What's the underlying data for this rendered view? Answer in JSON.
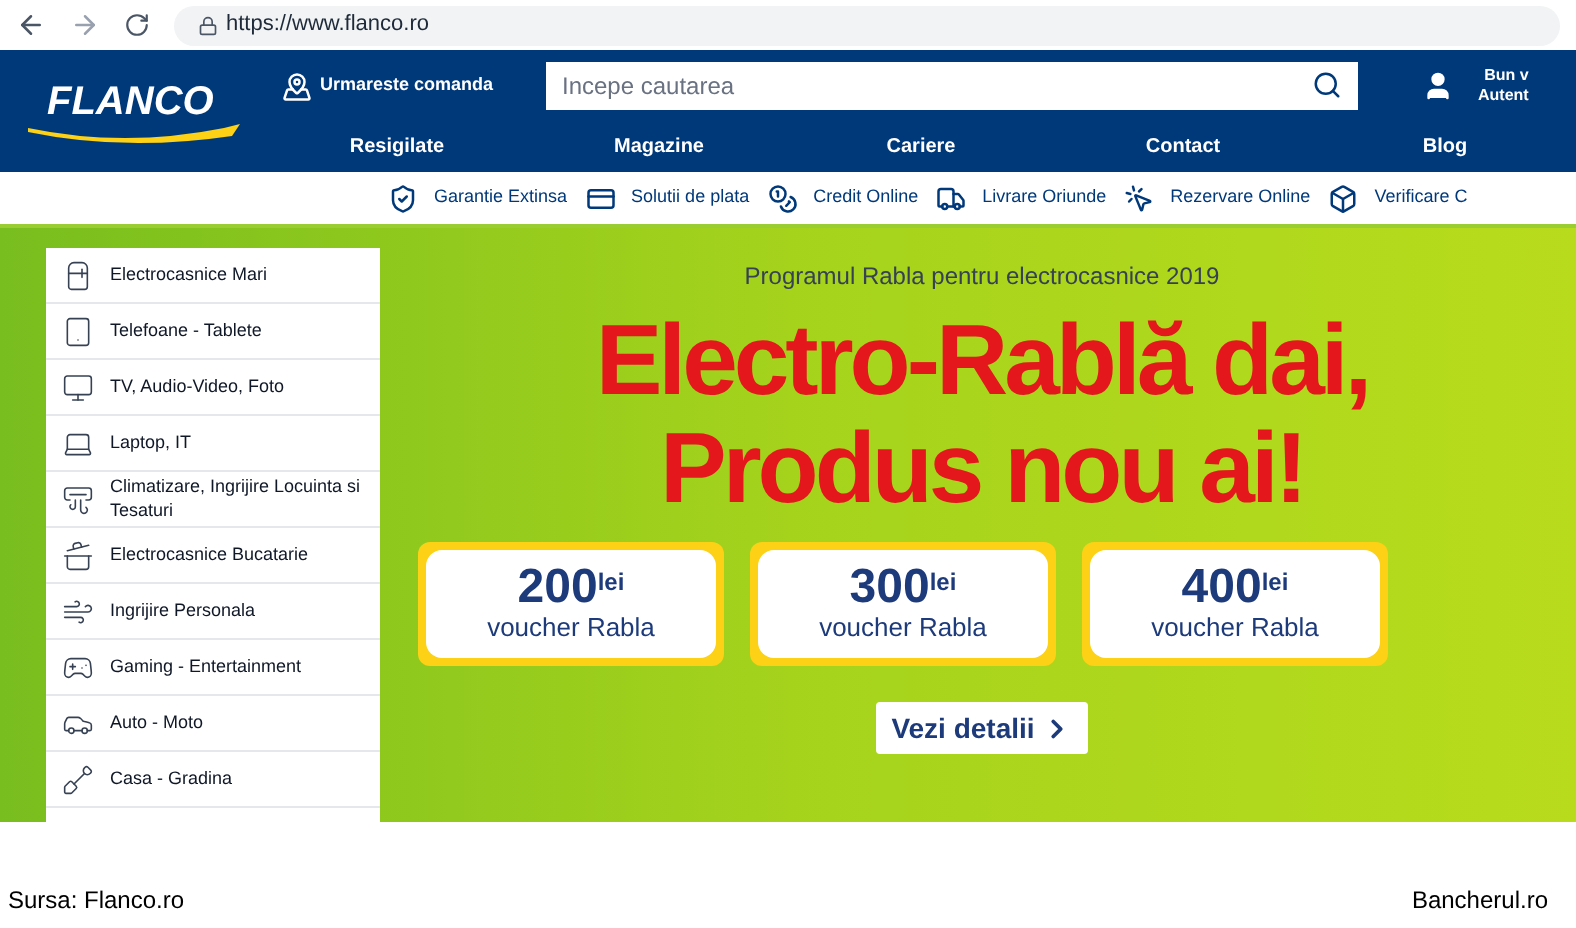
{
  "browser": {
    "url": "https://www.flanco.ro"
  },
  "header": {
    "logo": "FLANCO",
    "track_order": "Urmareste comanda",
    "search": {
      "placeholder": "Incepe cautarea"
    },
    "account": [
      "Bun v",
      "Autent"
    ],
    "nav": [
      "Resigilate",
      "Magazine",
      "Cariere",
      "Contact",
      "Blog"
    ]
  },
  "services": [
    "Garantie Extinsa",
    "Solutii de plata",
    "Credit Online",
    "Livrare Oriunde",
    "Rezervare Online",
    "Verificare C"
  ],
  "categories": [
    "Electrocasnice Mari",
    "Telefoane - Tablete",
    "TV, Audio-Video, Foto",
    "Laptop, IT",
    "Climatizare, Ingrijire Locuinta si Tesaturi",
    "Electrocasnice Bucatarie",
    "Ingrijire Personala",
    "Gaming - Entertainment",
    "Auto - Moto",
    "Casa - Gradina"
  ],
  "banner": {
    "subtitle": "Programul Rabla pentru electrocasnice 2019",
    "headline": [
      "Electro-Rablă dai,",
      "Produs nou ai!"
    ],
    "vouchers": [
      {
        "amount": "200$^{lei}$",
        "label": "voucher Rabla"
      },
      {
        "amount": "300$^{lei}$",
        "label": "voucher Rabla"
      },
      {
        "amount": "400$^{lei}$",
        "label": "voucher Rabla"
      }
    ],
    "cta": "Vezi detalii"
  },
  "footer": {
    "source": "Sursa: Flanco.ro",
    "credit": "Bancherul.ro"
  }
}
